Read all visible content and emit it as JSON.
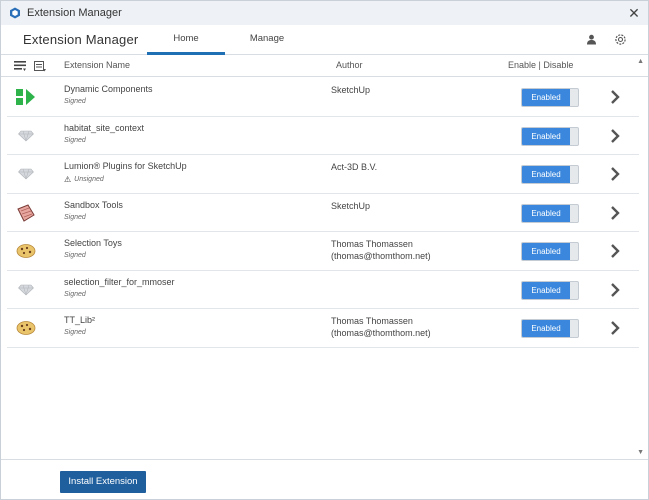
{
  "window": {
    "title": "Extension Manager",
    "close_glyph": "✕"
  },
  "header": {
    "brand": "Extension Manager",
    "tabs": [
      {
        "label": "Home",
        "active": true
      },
      {
        "label": "Manage",
        "active": false
      }
    ],
    "icons": [
      "user-icon",
      "gear-icon"
    ]
  },
  "columns": {
    "name": "Extension Name",
    "author": "Author",
    "enable": "Enable | Disable"
  },
  "extensions": [
    {
      "name": "Dynamic Components",
      "signature": "Signed",
      "author": "SketchUp",
      "author2": "",
      "status": "Enabled",
      "icon": "dynamic-components-icon"
    },
    {
      "name": "habitat_site_context",
      "signature": "Signed",
      "author": "",
      "author2": "",
      "status": "Enabled",
      "icon": "ruby-gem-icon"
    },
    {
      "name": "Lumion® Plugins for SketchUp",
      "signature": "Unsigned",
      "author": "Act-3D B.V.",
      "author2": "",
      "status": "Enabled",
      "icon": "ruby-gem-icon"
    },
    {
      "name": "Sandbox Tools",
      "signature": "Signed",
      "author": "SketchUp",
      "author2": "",
      "status": "Enabled",
      "icon": "sandbox-tools-icon"
    },
    {
      "name": "Selection Toys",
      "signature": "Signed",
      "author": "Thomas Thomassen",
      "author2": "(thomas@thomthom.net)",
      "status": "Enabled",
      "icon": "cookie-icon"
    },
    {
      "name": "selection_filter_for_mmoser",
      "signature": "Signed",
      "author": "",
      "author2": "",
      "status": "Enabled",
      "icon": "ruby-gem-icon"
    },
    {
      "name": "TT_Lib²",
      "signature": "Signed",
      "author": "Thomas Thomassen",
      "author2": "(thomas@thomthom.net)",
      "status": "Enabled",
      "icon": "cookie-icon"
    }
  ],
  "footer": {
    "install_label": "Install Extension"
  },
  "colors": {
    "accent": "#1f6fb5",
    "toggle_on": "#3a87dd",
    "button": "#1f5f9e"
  }
}
